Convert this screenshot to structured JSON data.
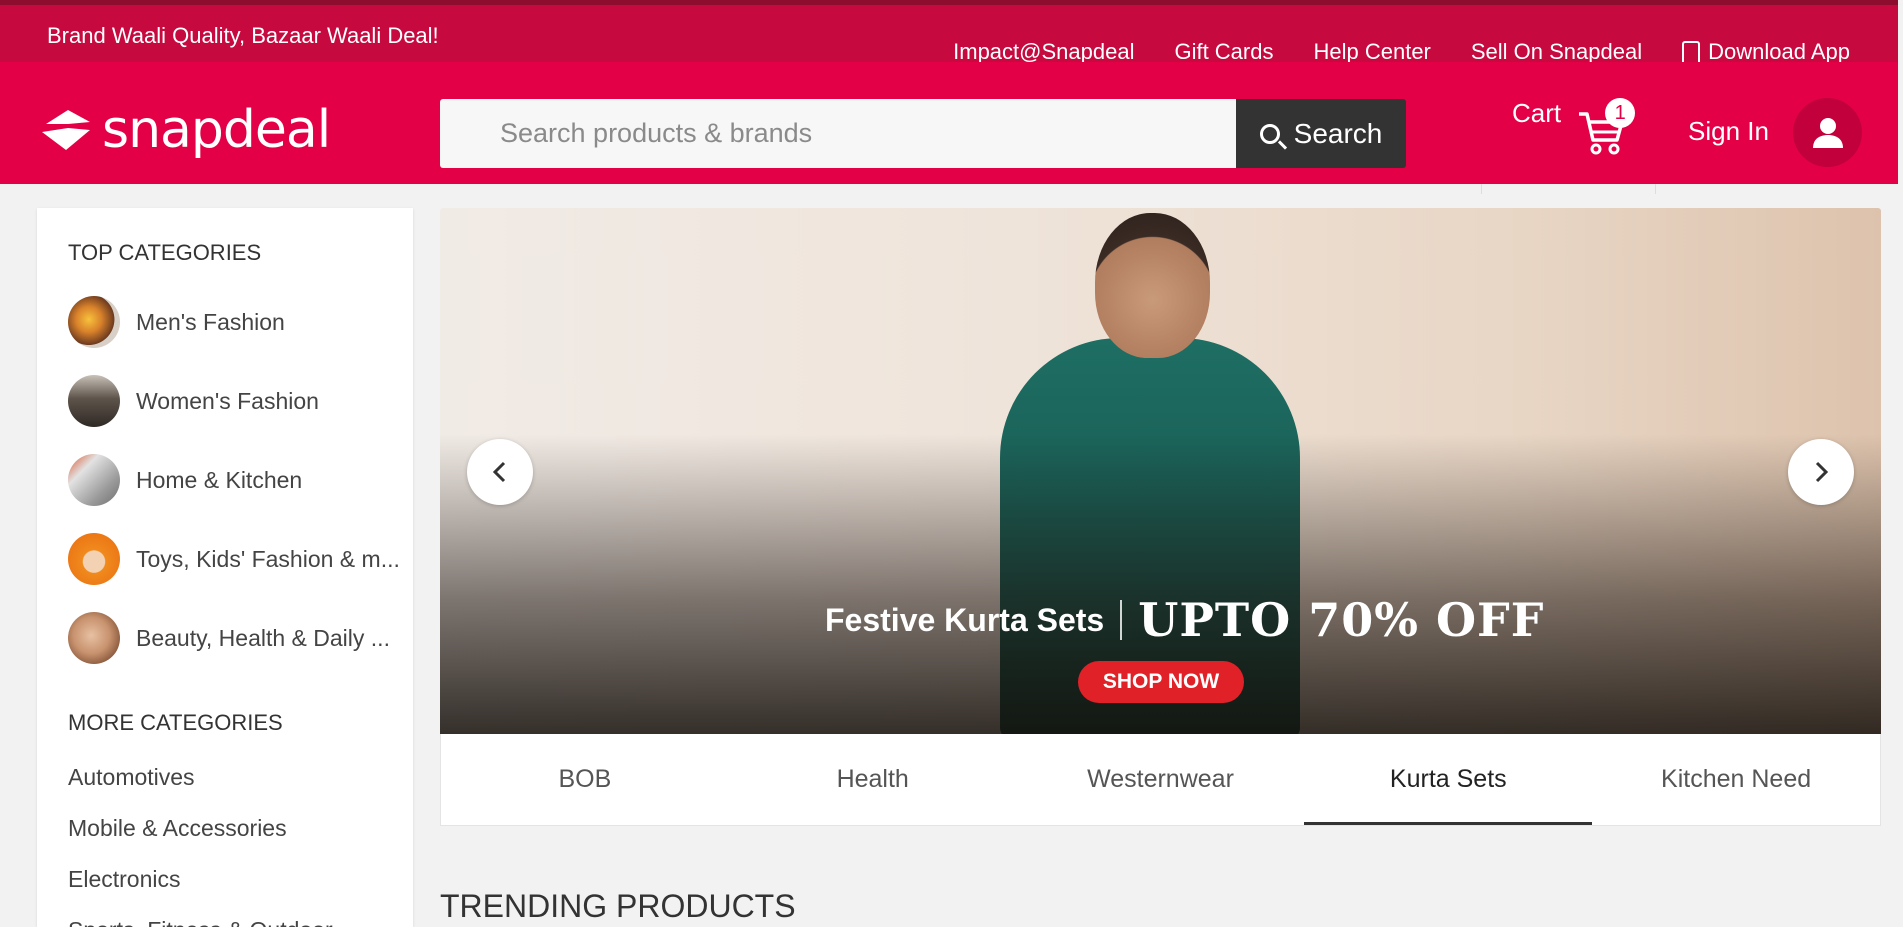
{
  "topbar": {
    "tagline": "Brand Waali Quality, Bazaar Waali Deal!",
    "links": [
      "Impact@Snapdeal",
      "Gift Cards",
      "Help Center",
      "Sell On Snapdeal",
      "Download App"
    ]
  },
  "header": {
    "logo_text": "snapdeal",
    "search": {
      "placeholder": "Search products & brands",
      "button_label": "Search"
    },
    "cart": {
      "label": "Cart",
      "count": "1"
    },
    "signin_label": "Sign In"
  },
  "sidebar": {
    "top_heading": "TOP CATEGORIES",
    "top_items": [
      "Men's Fashion",
      "Women's Fashion",
      "Home & Kitchen",
      "Toys, Kids' Fashion & m...",
      "Beauty, Health & Daily ..."
    ],
    "more_heading": "MORE CATEGORIES",
    "more_items": [
      "Automotives",
      "Mobile & Accessories",
      "Electronics",
      "Sports, Fitness & Outdoor"
    ]
  },
  "banner": {
    "headline_small": "Festive Kurta Sets",
    "headline_big": "UPTO 70% OFF",
    "cta": "SHOP NOW",
    "prev_icon": "chevron-left-icon",
    "next_icon": "chevron-right-icon"
  },
  "tabs": [
    "BOB",
    "Health",
    "Westernwear",
    "Kurta Sets",
    "Kitchen Need"
  ],
  "active_tab": "Kurta Sets",
  "section_title": "TRENDING PRODUCTS",
  "colors": {
    "brand": "#e40046",
    "topbar": "#c6093f",
    "search_button": "#333333"
  }
}
